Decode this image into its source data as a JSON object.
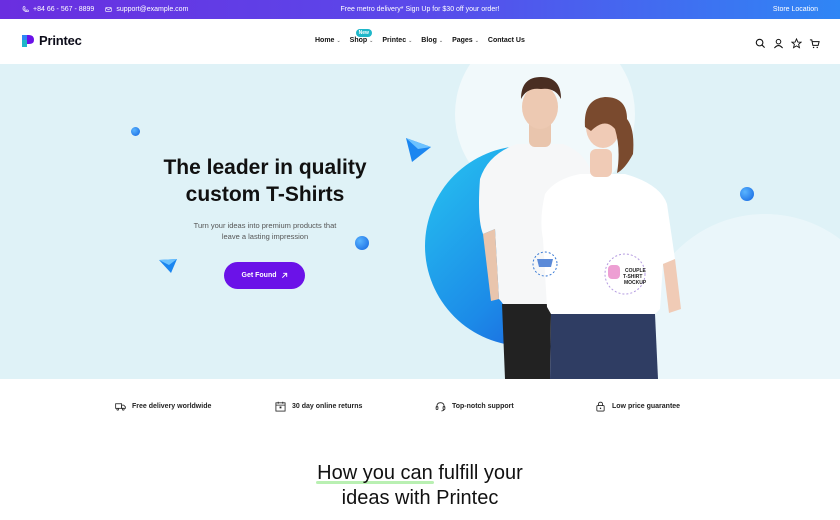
{
  "topbar": {
    "phone": "+84 66 - 567 - 8899",
    "email": "support@example.com",
    "promo": "Free metro delivery* Sign Up for $30 off your order!",
    "store_location": "Store Location"
  },
  "header": {
    "logo_text": "Printec",
    "nav": {
      "home": "Home",
      "shop": "Shop",
      "shop_badge": "New",
      "printec": "Printec",
      "blog": "Blog",
      "pages": "Pages",
      "contact": "Contact Us"
    },
    "icons": [
      "search-icon",
      "user-icon",
      "star-icon",
      "cart-icon"
    ]
  },
  "hero": {
    "title_line1": "The leader in quality",
    "title_line2": "custom T-Shirts",
    "subtitle_line1": "Turn your ideas into premium products that",
    "subtitle_line2": "leave a lasting impression",
    "cta_label": "Get Found",
    "shirt_print_line1": "COUPLE",
    "shirt_print_line2": "T-SHIRT",
    "shirt_print_line3": "MOCKUP"
  },
  "features": [
    {
      "label": "Free delivery worldwide",
      "icon": "truck-icon"
    },
    {
      "label": "30 day online returns",
      "icon": "calendar-icon"
    },
    {
      "label": "Top-notch support",
      "icon": "headset-icon"
    },
    {
      "label": "Low price guarantee",
      "icon": "lock-icon"
    }
  ],
  "section": {
    "title_line1": "How you can fulfill your",
    "title_line2": "ideas with Printec"
  },
  "colors": {
    "accent": "#6b12e8",
    "hero_bg": "#dff2f7",
    "badge": "#1fb7c9"
  }
}
